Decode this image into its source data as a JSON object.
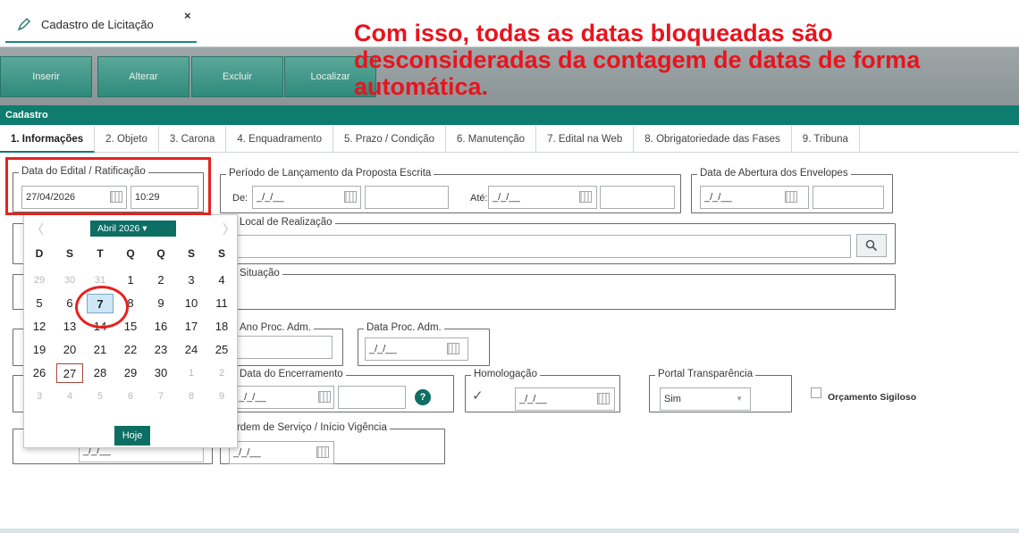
{
  "window": {
    "tab_title": "Cadastro de Licitação",
    "close_glyph": "×"
  },
  "annotation": "Com isso, todas as datas bloqueadas são desconsideradas da contagem de datas de forma automática.",
  "toolbar": {
    "insert": "Inserir",
    "edit": "Alterar",
    "delete": "Excluir",
    "find": "Localizar"
  },
  "section": {
    "title": "Cadastro"
  },
  "tabs": [
    "1. Informações",
    "2. Objeto",
    "3. Carona",
    "4. Enquadramento",
    "5. Prazo / Condição",
    "6. Manutenção",
    "7. Edital na Web",
    "8. Obrigatoriedade das Fases",
    "9. Tribuna"
  ],
  "fields": {
    "edital": {
      "legend": "Data do Edital / Ratificação",
      "date": "27/04/2026",
      "time": "10:29"
    },
    "proposta": {
      "legend": "Período de Lançamento da Proposta Escrita",
      "de_label": "De:",
      "ate_label": "Até:",
      "de_date": "_/_/__",
      "ate_date": "_/_/__"
    },
    "abertura": {
      "legend": "Data de Abertura dos Envelopes",
      "date": "_/_/__"
    },
    "local": {
      "legend": "Local de Realização"
    },
    "situacao": {
      "legend": "Situação"
    },
    "ano_proc": {
      "legend": "Ano Proc. Adm."
    },
    "data_proc": {
      "legend": "Data Proc. Adm.",
      "date": "_/_/__"
    },
    "encerramento": {
      "legend": "Data do Encerramento",
      "date": "_/_/__",
      "help": "?"
    },
    "homologacao": {
      "legend": "Homologação",
      "check": "✓",
      "date": "_/_/__"
    },
    "portal": {
      "legend": "Portal Transparência",
      "value": "Sim"
    },
    "orcamento": {
      "label": "Orçamento Sigiloso"
    },
    "ordem": {
      "legend": "Ordem de Serviço / Início Vigência",
      "date": "_/_/__",
      "left_date": "_/_/__"
    }
  },
  "calendar": {
    "month_label": "Abril 2026 ▾",
    "prev": "〈",
    "next": "〉",
    "weekdays": [
      "D",
      "S",
      "T",
      "Q",
      "Q",
      "S",
      "S"
    ],
    "weeks": [
      [
        "29",
        "30",
        "31",
        "1",
        "2",
        "3",
        "4"
      ],
      [
        "5",
        "6",
        "7",
        "8",
        "9",
        "10",
        "11"
      ],
      [
        "12",
        "13",
        "14",
        "15",
        "16",
        "17",
        "18"
      ],
      [
        "19",
        "20",
        "21",
        "22",
        "23",
        "24",
        "25"
      ],
      [
        "26",
        "27",
        "28",
        "29",
        "30",
        "1",
        "2"
      ],
      [
        "3",
        "4",
        "5",
        "6",
        "7",
        "8",
        "9"
      ]
    ],
    "muted": [
      [
        0,
        0
      ],
      [
        0,
        1
      ],
      [
        0,
        2
      ],
      [
        4,
        5
      ],
      [
        4,
        6
      ],
      [
        5,
        0
      ],
      [
        5,
        1
      ],
      [
        5,
        2
      ],
      [
        5,
        3
      ],
      [
        5,
        4
      ],
      [
        5,
        5
      ],
      [
        5,
        6
      ]
    ],
    "selected": [
      1,
      2
    ],
    "today": [
      4,
      1
    ],
    "today_button": "Hoje"
  },
  "colors": {
    "accent": "#0f7c70",
    "annotation": "#e8141e"
  }
}
